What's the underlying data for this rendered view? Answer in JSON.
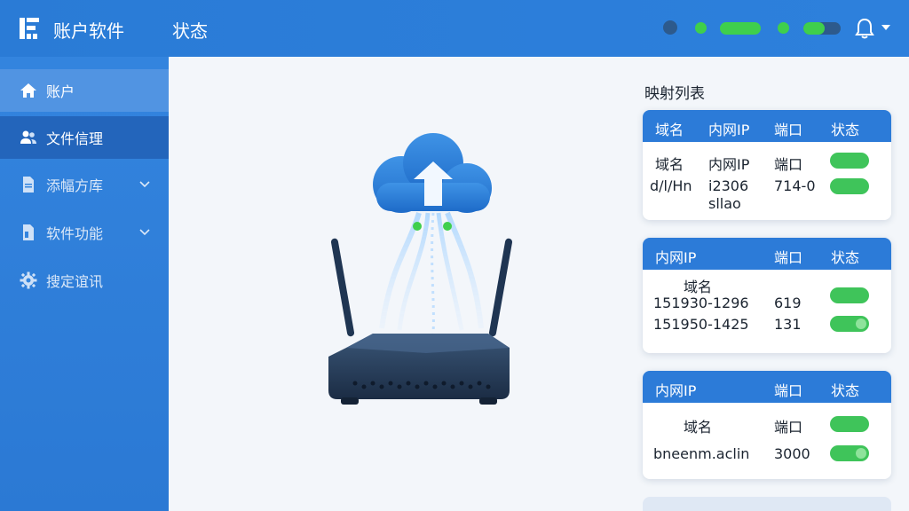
{
  "header": {
    "app_title": "账户软件",
    "page_title": "状态",
    "icons": [
      "logo-icon",
      "bell-icon",
      "chevron-down-icon"
    ],
    "colors": {
      "bar": "#2a7bd6",
      "status_dark": "#2d5a8c",
      "status_green": "#3fcf4c"
    }
  },
  "sidebar": {
    "items": [
      {
        "label": "账户",
        "icon": "home-icon"
      },
      {
        "label": "文件信理",
        "icon": "users-icon"
      },
      {
        "label": "添幅方库",
        "icon": "document-icon"
      },
      {
        "label": "软件功能",
        "icon": "document-icon"
      },
      {
        "label": "搜定谊讯",
        "icon": "gear-icon"
      }
    ]
  },
  "main": {
    "list_title": "映射列表",
    "cards": [
      {
        "headers": [
          "域名",
          "内网IP",
          "端口",
          "状态"
        ],
        "rows": [
          [
            "域名",
            "内网IP",
            "端口"
          ],
          [
            "d/l/Hn",
            "i2306",
            "714-0"
          ],
          [
            "",
            "sllao",
            ""
          ]
        ]
      },
      {
        "headers": [
          "内网IP",
          "端口",
          "状态"
        ],
        "rows": [
          [
            "域名",
            ""
          ],
          [
            "151930-1296",
            "619"
          ],
          [
            "151950-1425",
            "131"
          ]
        ]
      },
      {
        "headers": [
          "内网IP",
          "端口",
          "状态"
        ],
        "rows": [
          [
            "域名",
            "端口"
          ],
          [
            "bneenm.aclin",
            "3000"
          ]
        ]
      }
    ]
  }
}
